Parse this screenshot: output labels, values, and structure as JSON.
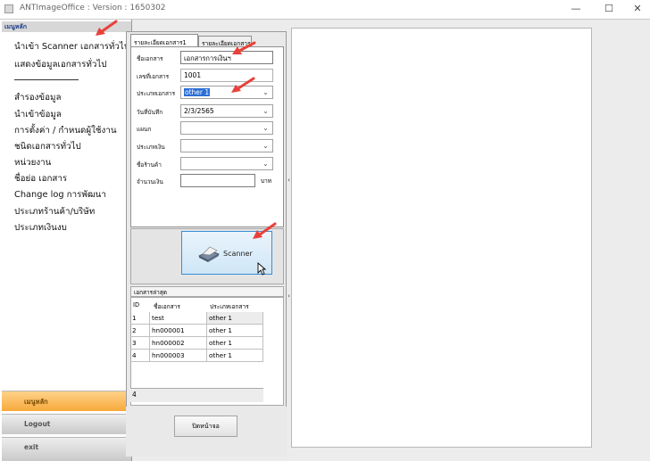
{
  "window": {
    "title": "ANTImageOffice : Version : 1650302",
    "minimize": "—",
    "maximize": "☐",
    "close": "✕"
  },
  "menu": {
    "header": "เมนูหลัก",
    "items_top": [
      "นำเข้า Scanner เอกสารทั่วไป",
      "แสดงข้อมูลเอกสารทั่วไป"
    ],
    "items_bottom": [
      "สำรองข้อมูล",
      "นำเข้าข้อมูล",
      "การตั้งค่า / กำหนดผู้ใช้งาน",
      "ชนิดเอกสารทั่วไป",
      "หน่วยงาน",
      "ชื่อย่อ เอกสาร",
      "Change log การพัฒนา",
      "ประเภทร้านค้า/บริษัท",
      "ประเภทเงินงบ"
    ],
    "btn_main": "เมนูหลัก",
    "btn_logout": "Logout",
    "btn_exit": "exit"
  },
  "tabs": [
    "รายละเอียดเอกสาร1",
    "รายละเอียดเอกสาร2"
  ],
  "form": {
    "doc_name": {
      "label": "ชื่อเอกสาร",
      "value": "เอกสารการเงินฯ"
    },
    "doc_no": {
      "label": "เลขที่เอกสาร",
      "value": "1001"
    },
    "doc_type": {
      "label": "ประเภทเอกสาร",
      "value": "other 1"
    },
    "record_date": {
      "label": "วันที่บันทึก",
      "value": "2/3/2565"
    },
    "department": {
      "label": "แผนก",
      "value": ""
    },
    "money_type": {
      "label": "ประเภทเงิน",
      "value": ""
    },
    "shop_name": {
      "label": "ชื่อร้านค้า",
      "value": ""
    },
    "amount": {
      "label": "จำนวนเงิน",
      "value": "",
      "unit": "บาท"
    }
  },
  "scanner": {
    "label": "Scanner"
  },
  "recent": {
    "title": "เอกสารล่าสุด",
    "columns": [
      "ID",
      "ชื่อเอกสาร",
      "ประเภทเอกสาร"
    ],
    "rows": [
      [
        "1",
        "test",
        "other 1"
      ],
      [
        "2",
        "hn000001",
        "other 1"
      ],
      [
        "3",
        "hn000002",
        "other 1"
      ],
      [
        "4",
        "hn000003",
        "other 1"
      ]
    ],
    "count": "4"
  },
  "close_button": "ปิดหน้าจอ",
  "colors": {
    "accent_arrow": "#e8413a",
    "selection": "#2b6fd6",
    "main_button": "#f7a93b"
  }
}
